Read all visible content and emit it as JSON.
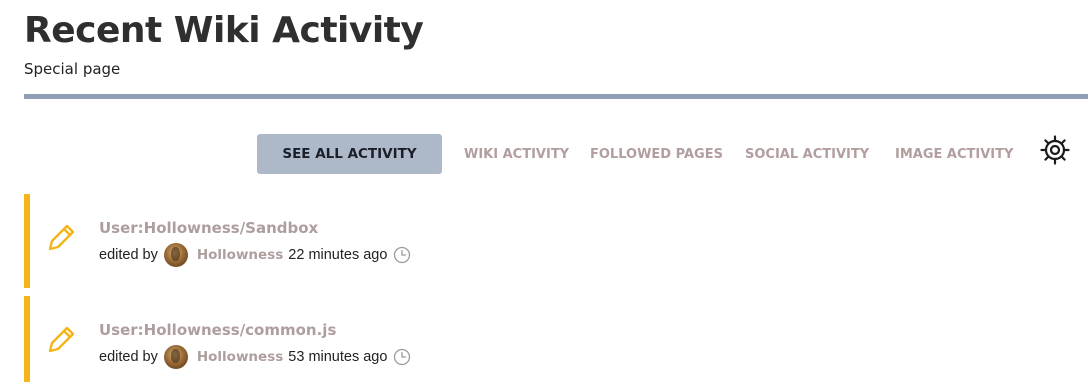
{
  "header": {
    "title": "Recent Wiki Activity",
    "subtitle": "Special page"
  },
  "tabs": {
    "active": "SEE ALL ACTIVITY",
    "items": [
      "WIKI ACTIVITY",
      "FOLLOWED PAGES",
      "SOCIAL ACTIVITY",
      "IMAGE ACTIVITY"
    ]
  },
  "settings_icon": "gear-icon",
  "colors": {
    "accent_bar": "#f5b417",
    "divider": "#8f9eb3",
    "active_tab_bg": "#adb9c9",
    "link": "#ae9e9e"
  },
  "activity": [
    {
      "icon": "pencil-icon",
      "title": "User:Hollowness/Sandbox",
      "prefix": "edited by",
      "user": "Hollowness",
      "time": "22 minutes ago"
    },
    {
      "icon": "pencil-icon",
      "title": "User:Hollowness/common.js",
      "prefix": "edited by",
      "user": "Hollowness",
      "time": "53 minutes ago"
    }
  ]
}
